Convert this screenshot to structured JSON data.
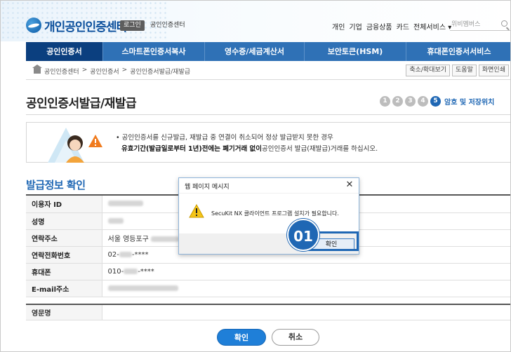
{
  "header": {
    "logo_text": "개인공인인증센터",
    "login_label": "로그인",
    "site_name": "공인인증센터",
    "util_links": [
      "개인",
      "기업",
      "금융상품",
      "카드",
      "전체서비스 ▾"
    ],
    "search_placeholder": "위비멤버스"
  },
  "nav": {
    "items": [
      "공인인증서",
      "스마트폰인증서복사",
      "영수증/세금계산서",
      "보안토큰(HSM)",
      "휴대폰인증서서비스"
    ]
  },
  "breadcrumb": {
    "items": [
      "공인인증센터",
      ">",
      "공인인증서",
      ">",
      "공인인증서발급/재발급"
    ],
    "buttons": [
      "축소/확대보기",
      "도움말",
      "화면인쇄"
    ]
  },
  "page": {
    "title": "공인인증서발급/재발급",
    "steps": [
      "1",
      "2",
      "3",
      "4",
      "5"
    ],
    "active_step_label": "암호 및 저장위치"
  },
  "notice": {
    "line1": "• 공인인증서를 신규발급, 재발급 중 연결이 취소되어 정상 발급받지 못한 경우",
    "line2_bold": "유효기간(발급일로부터 1년)전에는 폐기거래 없이",
    "line2_rest": "공인인증서 발급(재발급)거래를 하십시오."
  },
  "section": {
    "title": "발급정보 확인"
  },
  "form": {
    "rows": [
      {
        "label": "이용자 ID",
        "value": ""
      },
      {
        "label": "성명",
        "value": ""
      },
      {
        "label": "연락주소",
        "value": "서울 영등포구"
      },
      {
        "label": "연락전화번호",
        "value": "02-",
        "suffix": "-****"
      },
      {
        "label": "휴대폰",
        "value": "010-",
        "suffix": "-****"
      },
      {
        "label": "E-mail주소",
        "value": ""
      }
    ],
    "extra_label": "영문명"
  },
  "actions": {
    "confirm": "확인",
    "cancel": "취소"
  },
  "dialog": {
    "title": "웹 페이지 메시지",
    "close": "✕",
    "message": "SecuKit NX 클라이언트 프로그램 설치가 필요합니다.",
    "ok": "확인"
  },
  "callout": {
    "label": "01"
  },
  "colors": {
    "primary": "#1f67b4",
    "nav_active": "#0b3f7f",
    "nav_bg": "#2f71b6"
  }
}
